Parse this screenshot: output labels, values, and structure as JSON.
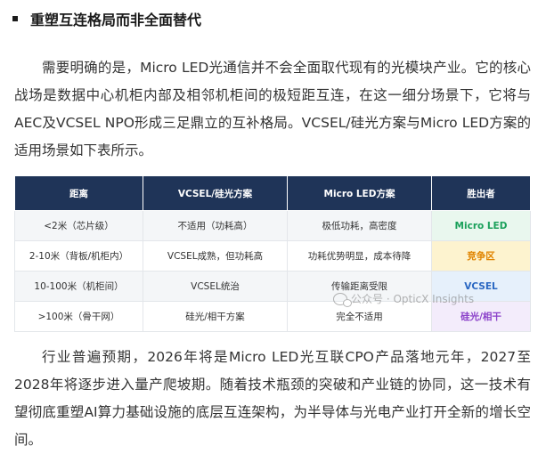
{
  "heading": {
    "text": "重塑互连格局而非全面替代"
  },
  "paragraphs": [
    "需要明确的是，Micro LED光通信并不会全面取代现有的光模块产业。它的核心战场是数据中心机柜内部及相邻机柜间的极短距互连，在这一细分场景下，它将与AEC及VCSEL NPO形成三足鼎立的互补格局。VCSEL/硅光方案与Micro LED方案的适用场景如下表所示。",
    "行业普遍预期，2026年将是Micro LED光互联CPO产品落地元年，2027至2028年将逐步进入量产爬坡期。随着技术瓶颈的突破和产业链的协同，这一技术有望彻底重塑AI算力基础设施的底层互连架构，为半导体与光电产业打开全新的增长空间。"
  ],
  "table": {
    "headers": [
      "距离",
      "VCSEL/硅光方案",
      "Micro LED方案",
      "胜出者"
    ],
    "rows": [
      [
        "<2米（芯片级）",
        "不适用（功耗高）",
        "极低功耗，高密度",
        "Micro LED"
      ],
      [
        "2-10米（背板/机柜内）",
        "VCSEL成熟，但功耗高",
        "功耗优势明显，成本待降",
        "竞争区"
      ],
      [
        "10-100米（机柜间）",
        "VCSEL统治",
        "传输距离受限",
        "VCSEL"
      ],
      [
        ">100米（骨干网）",
        "硅光/相干方案",
        "完全不适用",
        "硅光/相干"
      ]
    ]
  },
  "colors": {
    "header_bg": "#1f3458",
    "winner_green": "#1aa05a",
    "winner_orange": "#e08400",
    "winner_blue": "#2a67c2",
    "winner_purple": "#8a3fc9"
  },
  "watermark": {
    "text": "公众号 · OpticX Insights",
    "icon": "wechat-icon"
  }
}
